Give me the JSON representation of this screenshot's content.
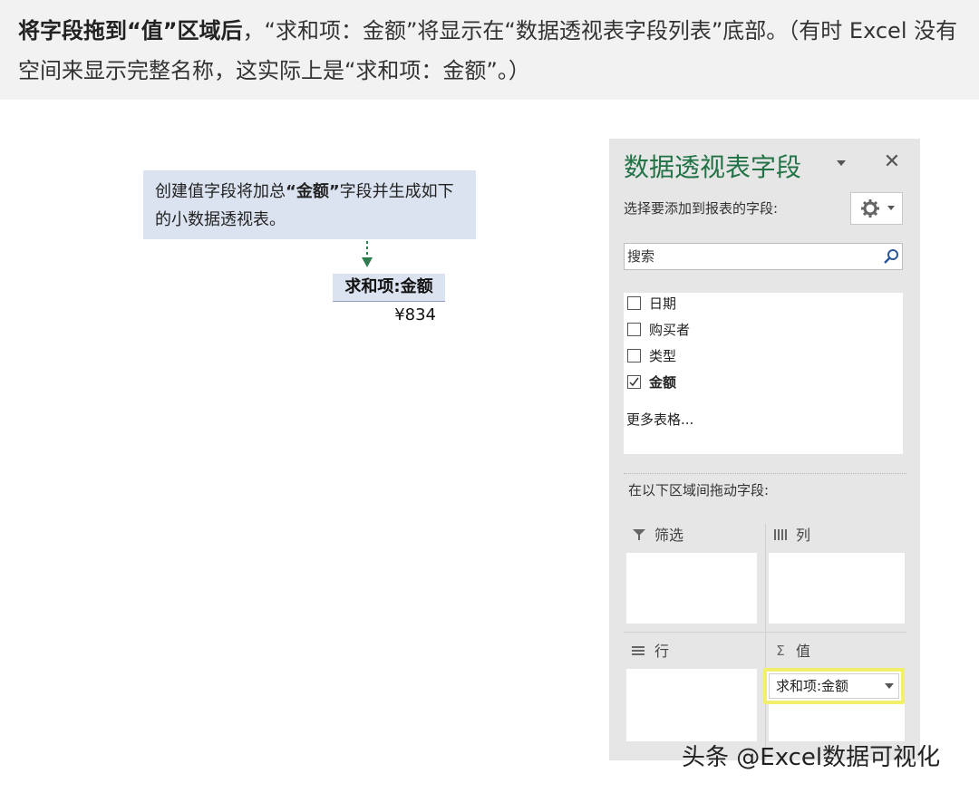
{
  "banner": {
    "bold_lead": "将字段拖到“值”区域后",
    "text": "，“求和项：金额”将显示在“数据透视表字段列表”底部。（有时 Excel 没有空间来显示完整名称，这实际上是“求和项：金额”。）"
  },
  "callout": {
    "text_before": "创建值字段将加总",
    "bold_word": "“金额”",
    "text_after": "字段并生成如下的小数据透视表。"
  },
  "mini_pivot": {
    "header": "求和项:金额",
    "value": "¥834"
  },
  "pane": {
    "title": "数据透视表字段",
    "choose_label": "选择要添加到报表的字段:",
    "search_placeholder": "搜索",
    "fields": [
      {
        "label": "日期",
        "checked": false
      },
      {
        "label": "购买者",
        "checked": false
      },
      {
        "label": "类型",
        "checked": false
      },
      {
        "label": "金额",
        "checked": true
      }
    ],
    "more_tables": "更多表格...",
    "drag_label": "在以下区域间拖动字段:",
    "areas": {
      "filter": "筛选",
      "columns": "列",
      "rows": "行",
      "values": "值"
    },
    "value_field": "求和项:金额"
  },
  "colors": {
    "title_green": "#217346",
    "highlight_yellow": "#f2f06a",
    "callout_blue": "#dce3f0"
  },
  "watermark": "头条 @Excel数据可视化"
}
